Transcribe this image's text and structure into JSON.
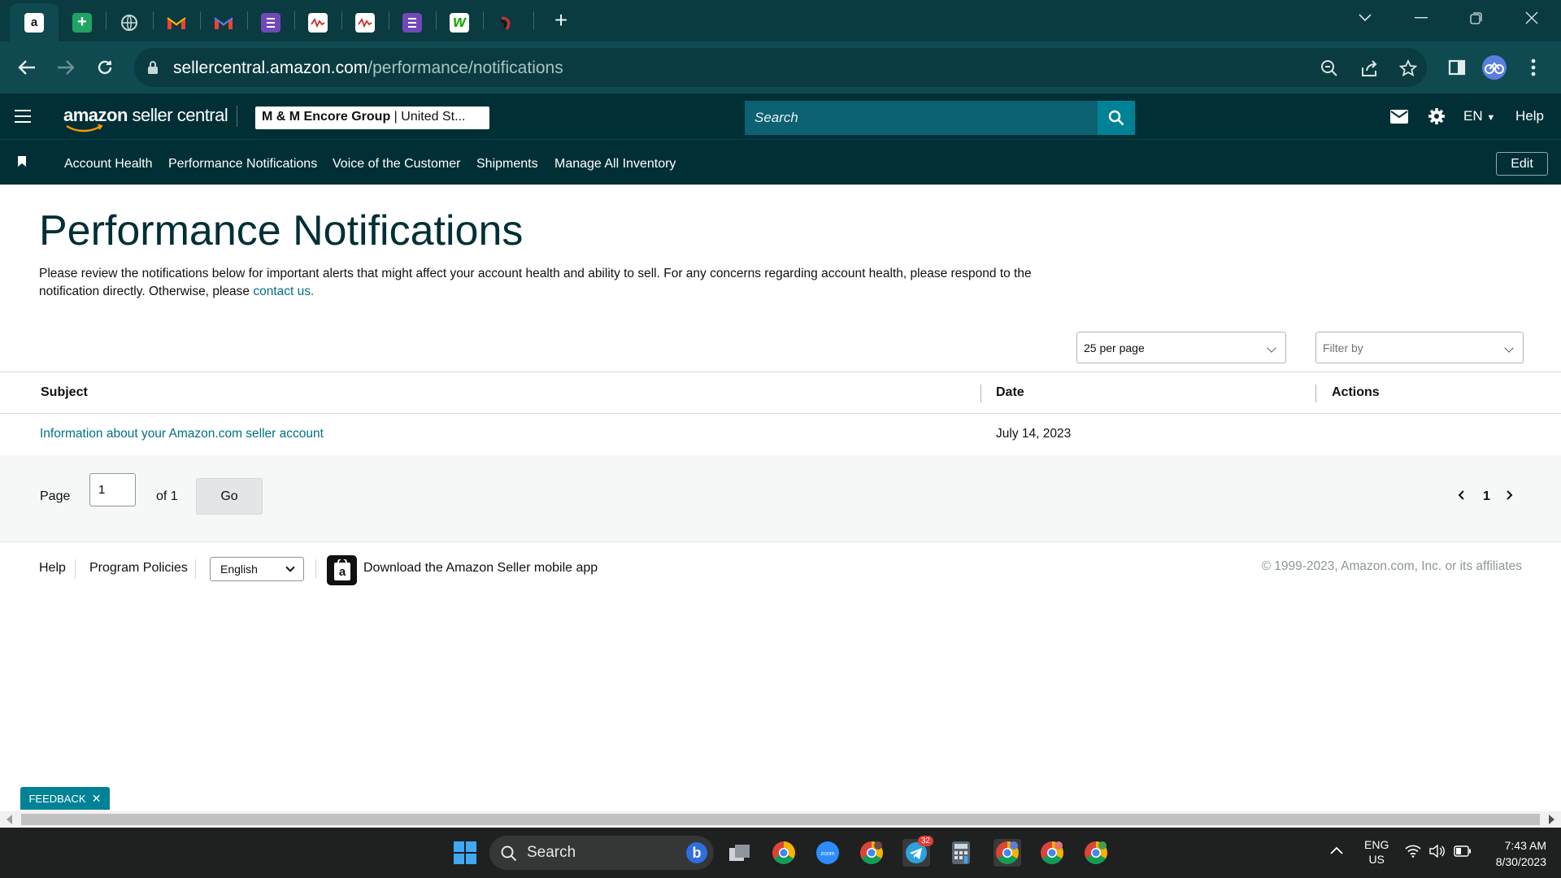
{
  "browser": {
    "url_domain": "sellercentral.amazon.com",
    "url_path": "/performance/notifications",
    "tabs": [
      {
        "icon": "amazon-icon"
      },
      {
        "icon": "google-sheets-icon"
      },
      {
        "icon": "globe-icon"
      },
      {
        "icon": "gmail-icon"
      },
      {
        "icon": "gmail-icon"
      },
      {
        "icon": "forms-icon"
      },
      {
        "icon": "chart-doc-icon"
      },
      {
        "icon": "chart-doc-icon"
      },
      {
        "icon": "forms-icon"
      },
      {
        "icon": "upwork-icon"
      },
      {
        "icon": "red-logo-icon"
      }
    ]
  },
  "header": {
    "logo_brand": "amazon",
    "logo_suffix": " seller central",
    "merchant_name": "M & M Encore Group",
    "merchant_region": " | United St...",
    "search_placeholder": "Search",
    "language": "EN",
    "help": "Help"
  },
  "nav": {
    "items": [
      "Account Health",
      "Performance Notifications",
      "Voice of the Customer",
      "Shipments",
      "Manage All Inventory"
    ],
    "edit": "Edit"
  },
  "main": {
    "title": "Performance Notifications",
    "description": "Please review the notifications below for important alerts that might affect your account health and ability to sell. For any concerns regarding account health, please respond to the notification directly. Otherwise, please ",
    "contact_link": "contact us.",
    "per_page": "25 per page",
    "filter_placeholder": "Filter by",
    "table": {
      "columns": [
        "Subject",
        "Date",
        "Actions"
      ],
      "rows": [
        {
          "subject": "Information about your Amazon.com seller account",
          "date": "July 14, 2023",
          "actions": ""
        }
      ]
    },
    "pagination": {
      "page_label": "Page",
      "page_value": "1",
      "of_label": "of 1",
      "go": "Go",
      "current": "1"
    }
  },
  "footer": {
    "help": "Help",
    "policies": "Program Policies",
    "language": "English",
    "app_text": "Download the Amazon Seller mobile app",
    "copyright": "© 1999-2023, Amazon.com, Inc. or its affiliates"
  },
  "feedback": "FEEDBACK",
  "taskbar": {
    "search": "Search",
    "lang_top": "ENG",
    "lang_bottom": "US",
    "time": "7:43 AM",
    "date": "8/30/2023",
    "telegram_badge": "32"
  },
  "colors": {
    "chrome_dark": "#0a3b40",
    "chrome_toolbar": "#0f4a50",
    "sc_header": "#002f36",
    "link": "#007185",
    "accent": "#008296"
  }
}
